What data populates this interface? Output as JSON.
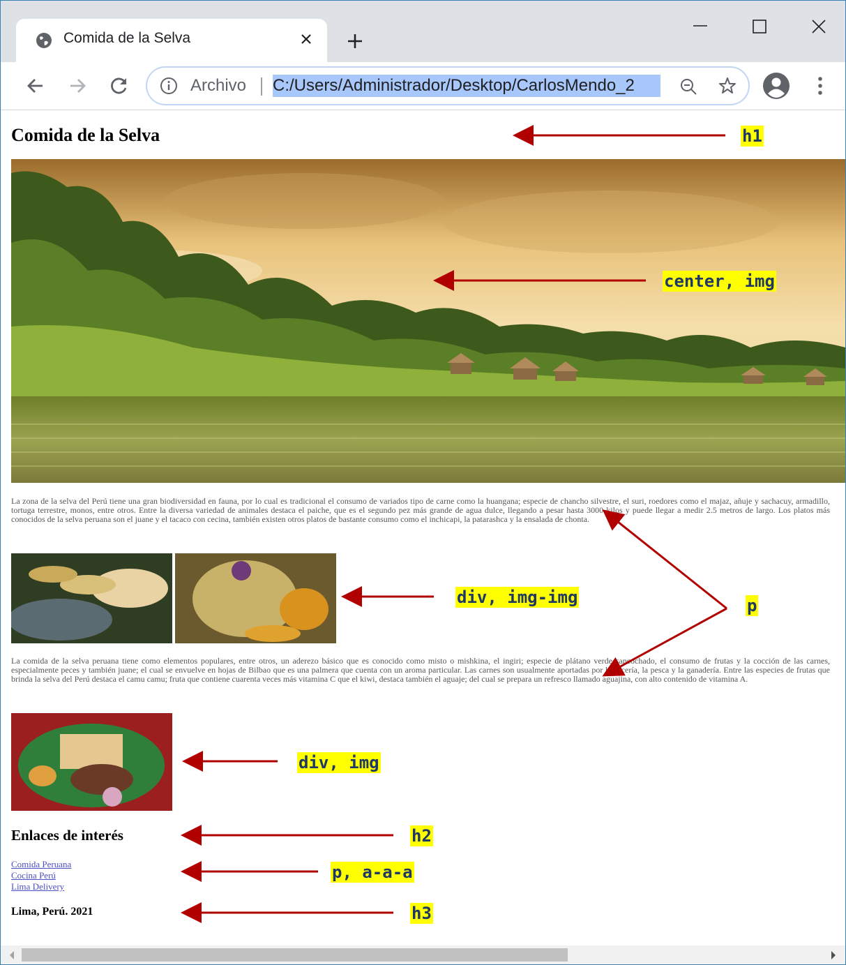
{
  "tab": {
    "title": "Comida de la Selva"
  },
  "omnibox": {
    "label": "Archivo",
    "url": "C:/Users/Administrador/Desktop/CarlosMendo_2"
  },
  "page": {
    "h1": "Comida de la Selva",
    "p1": "La zona de la selva del Perú tiene una gran biodiversidad en fauna, por lo cual es tradicional el consumo de variados tipo de carne como la huangana; especie de chancho silvestre, el suri, roedores como el majaz, añuje y sachacuy, armadillo, tortuga terrestre, monos, entre otros. Entre la diversa variedad de animales destaca el paiche, que es el segundo pez más grande de agua dulce, llegando a pesar hasta 3000 kilos y puede llegar a medir 2.5 metros de largo. Los platos más conocidos de la selva peruana son el juane y el tacaco con cecina, también existen otros platos de bastante consumo como el inchicapi, la patarashca y la ensalada de chonta.",
    "p2": "La comida de la selva peruana tiene como elementos populares, entre otros, un aderezo básico que es conocido como misto o mishkina, el ingiri; especie de plátano verde sancochado, el consumo de frutas y la cocción de las carnes, especialmente peces y también juane; el cual se envuelve en hojas de Bilbao que es una palmera que cuenta con un aroma particular. Las carnes son usualmente aportadas por la cacería, la pesca y la ganadería. Entre las especies de frutas que brinda la selva del Perú destaca el camu camu; fruta que contiene cuarenta veces más vitamina C que el kiwi, destaca también el aguaje; del cual se prepara un refresco llamado aguajina, con alto contenido de vitamina A.",
    "h2": "Enlaces de interés",
    "links": [
      "Comida Peruana",
      "Cocina Perú",
      "Lima Delivery"
    ],
    "h3": "Lima, Perú. 2021"
  },
  "annotations": {
    "h1": "h1",
    "center_img": "center, img",
    "div_img_img": "div, img-img",
    "p": "p",
    "div_img": "div, img",
    "h2": "h2",
    "p_links": "p, a-a-a",
    "h3": "h3",
    "arrow_color": "#b00000",
    "highlight_color": "#ffff00"
  },
  "icons": [
    "globe-icon",
    "close-icon",
    "plus-icon",
    "minimize-icon",
    "maximize-icon",
    "back-arrow-icon",
    "forward-arrow-icon",
    "reload-icon",
    "info-icon",
    "zoom-out-icon",
    "star-icon",
    "profile-icon",
    "kebab-menu-icon"
  ]
}
